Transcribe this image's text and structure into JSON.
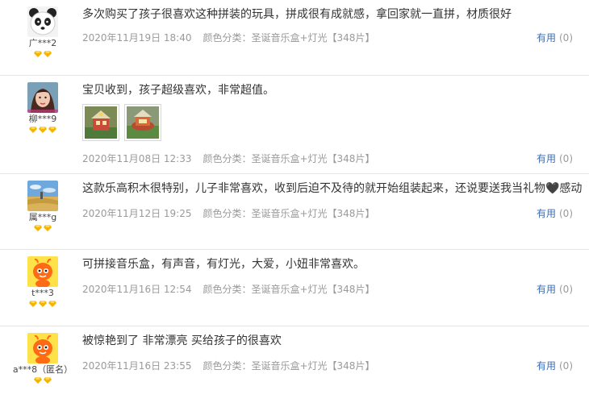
{
  "colors": {
    "link": "#3b6fb6",
    "meta": "#9a9a9a",
    "badge": "#f5b400",
    "divider": "#e5e5e5"
  },
  "reviews": [
    {
      "username": "广***2",
      "avatar": "panda-avatar",
      "badge_count": 2,
      "content": "多次购买了孩子很喜欢这种拼装的玩具，拼成很有成就感，拿回家就一直拼，材质很好",
      "date": "2020年11月19日 18:40",
      "spec": "颜色分类：圣诞音乐盒+灯光【348片】",
      "helpful_label": "有用",
      "helpful_count": "(0)"
    },
    {
      "username": "柳***9",
      "avatar": "girl-photo-avatar",
      "badge_count": 3,
      "content": "宝贝收到，孩子超级喜欢，非常超值。",
      "photos": [
        "music-box-photo",
        "music-box-photo"
      ],
      "date": "2020年11月08日 12:33",
      "spec": "颜色分类：圣诞音乐盒+灯光【348片】",
      "helpful_label": "有用",
      "helpful_count": "(0)"
    },
    {
      "username": "属***g",
      "avatar": "landscape-avatar",
      "badge_count": 2,
      "content": "这款乐高积木很特别，儿子非常喜欢，收到后迫不及待的就开始组装起来，还说要送我当礼物🖤感动",
      "date": "2020年11月12日 19:25",
      "spec": "颜色分类：圣诞音乐盒+灯光【348片】",
      "helpful_label": "有用",
      "helpful_count": "(0)"
    },
    {
      "username": "t***3",
      "avatar": "taobao-doll-avatar",
      "badge_count": 3,
      "content": "可拼接音乐盒，有声音，有灯光，大爱，小妞非常喜欢。",
      "date": "2020年11月16日 12:54",
      "spec": "颜色分类：圣诞音乐盒+灯光【348片】",
      "helpful_label": "有用",
      "helpful_count": "(0)"
    },
    {
      "username": "a***8（匿名）",
      "avatar": "taobao-doll-avatar",
      "badge_count": 2,
      "content": "被惊艳到了 非常漂亮 买给孩子的很喜欢",
      "date": "2020年11月16日 23:55",
      "spec": "颜色分类：圣诞音乐盒+灯光【348片】",
      "helpful_label": "有用",
      "helpful_count": "(0)"
    }
  ]
}
